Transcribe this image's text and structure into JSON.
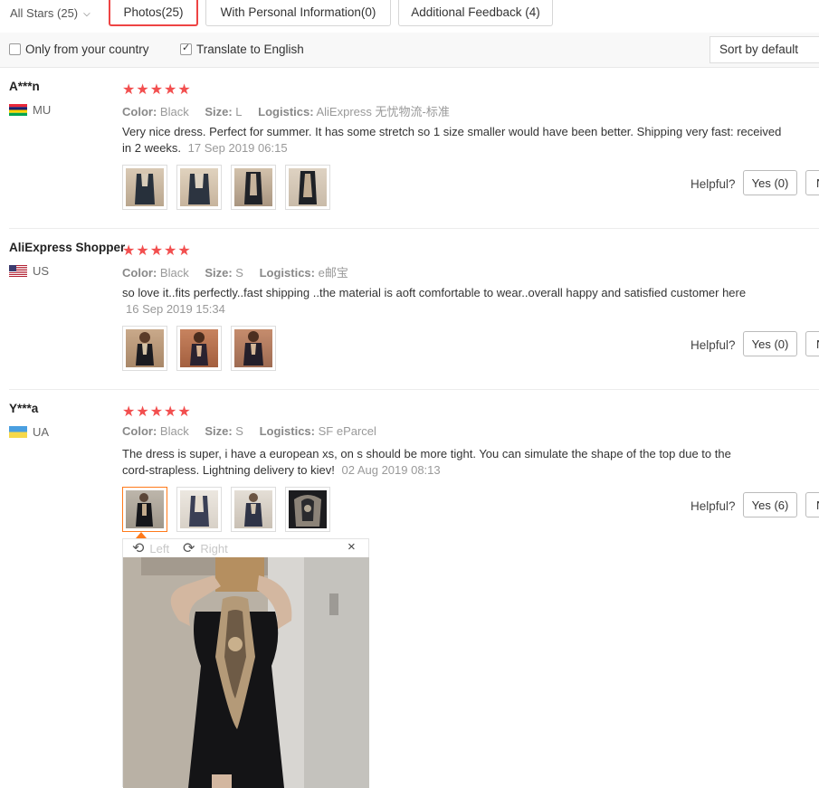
{
  "filters": {
    "all_stars": "All Stars (25)",
    "tabs": [
      "Photos(25)",
      "With Personal Information(0)",
      "Additional Feedback (4)"
    ]
  },
  "options": {
    "only_country": "Only from your country",
    "translate": "Translate to English",
    "sort": "Sort by default"
  },
  "colors": {
    "accent": "#e44444",
    "star": "#f24f4f",
    "selected_thumb": "#ff7a1a"
  },
  "reviews": [
    {
      "name": "A***n",
      "country": "MU",
      "stars": "★★★★★",
      "color_label": "Color:",
      "color": "Black",
      "size_label": "Size:",
      "size": "L",
      "logistics_label": "Logistics:",
      "logistics": "AliExpress 无忧物流-标准",
      "text": "Very nice dress. Perfect for summer. It has some stretch so 1 size smaller would have been better. Shipping very fast: received in 2 weeks.",
      "date": "17 Sep 2019 06:15",
      "helpful": "Helpful?",
      "yes": "Yes (0)",
      "no": "N"
    },
    {
      "name": "AliExpress Shopper",
      "country": "US",
      "stars": "★★★★★",
      "color_label": "Color:",
      "color": "Black",
      "size_label": "Size:",
      "size": "S",
      "logistics_label": "Logistics:",
      "logistics": "e邮宝",
      "text": "so love it..fits perfectly..fast shipping ..the material is aoft comfortable to wear..overall happy and satisfied customer here",
      "date": "16 Sep 2019 15:34",
      "helpful": "Helpful?",
      "yes": "Yes (0)",
      "no": "N"
    },
    {
      "name": "Y***a",
      "country": "UA",
      "stars": "★★★★★",
      "color_label": "Color:",
      "color": "Black",
      "size_label": "Size:",
      "size": "S",
      "logistics_label": "Logistics:",
      "logistics": "SF eParcel",
      "text": "The dress is super, i have a european xs, on s should be more tight. You can simulate the shape of the top due to the cord-strapless. Lightning delivery to kiev!",
      "date": "02 Aug 2019 08:13",
      "helpful": "Helpful?",
      "yes": "Yes (6)",
      "no": "N"
    }
  ],
  "viewer": {
    "rotate_left": "Left",
    "rotate_right": "Right",
    "close": "×"
  }
}
